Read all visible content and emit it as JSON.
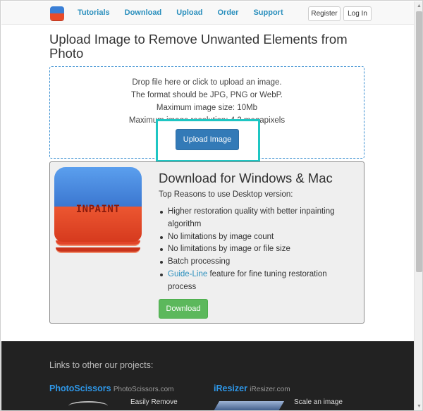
{
  "nav": {
    "links": [
      "Tutorials",
      "Download",
      "Upload",
      "Order",
      "Support"
    ],
    "register_label": "Register",
    "login_label": "Log In"
  },
  "upload": {
    "title": "Upload Image to Remove Unwanted Elements from Photo",
    "drop_lines": [
      "Drop file here or click to upload an image.",
      "The format should be JPG, PNG or WebP.",
      "Maximum image size: 10Mb",
      "Maximum image resolution: 4.2 megapixels"
    ],
    "button_label": "Upload Image"
  },
  "download": {
    "icon_label": "INPAINT",
    "title": "Download for Windows & Mac",
    "subtitle": "Top Reasons to use Desktop version:",
    "reasons": [
      {
        "text": "Higher restoration quality with better inpainting algorithm"
      },
      {
        "text": "No limitations by image count"
      },
      {
        "text": "No limitations by image or file size"
      },
      {
        "text": "Batch processing"
      },
      {
        "link": "Guide-Line",
        "text": " feature for fine tuning restoration process"
      }
    ],
    "button_label": "Download"
  },
  "footer": {
    "title": "Links to other our projects:",
    "projects": [
      {
        "brand": "PhotoScissors",
        "domain": "PhotoScissors.com",
        "desc": "Easily Remove"
      },
      {
        "brand": "iResizer",
        "domain": "iResizer.com",
        "desc": "Scale an image"
      }
    ]
  },
  "colors": {
    "accent_link": "#2a8fbd",
    "primary_button": "#337ab7",
    "success_button": "#5cb85c",
    "highlight": "#1ec6c3",
    "footer_bg": "#222222"
  }
}
